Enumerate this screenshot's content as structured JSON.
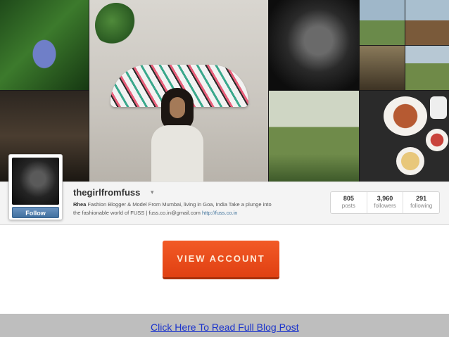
{
  "profile": {
    "username": "thegirlfromfuss",
    "caret_icon": "▾",
    "bio_name": "Rhea",
    "bio_text_line1": "Fashion Blogger & Model From Mumbai, living in Goa, India Take a plunge into",
    "bio_text_line2": "the fashionable world of FUSS | fuss.co.in@gmail.com",
    "bio_link": "http://fuss.co.in",
    "follow_label": "Follow",
    "avatar_icon": "profile-photo"
  },
  "stats": [
    {
      "count": "805",
      "label": "posts"
    },
    {
      "count": "3,960",
      "label": "followers"
    },
    {
      "count": "291",
      "label": "following"
    }
  ],
  "cta": {
    "label": "VIEW ACCOUNT",
    "color": "#e8471a"
  },
  "footer": {
    "link_text": "Click Here To Read Full Blog Post",
    "link_color": "#1a33cc"
  }
}
